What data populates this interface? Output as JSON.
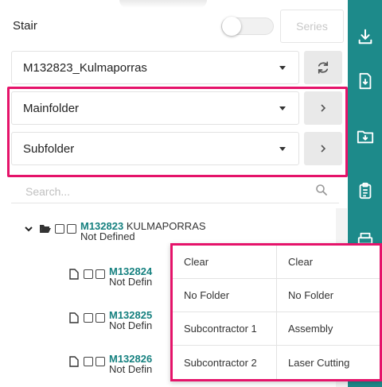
{
  "header": {
    "stair_label": "Stair",
    "series_label": "Series"
  },
  "dropdowns": {
    "project": "M132823_Kulmaporras",
    "mainfolder": "Mainfolder",
    "subfolder": "Subfolder"
  },
  "search": {
    "placeholder": "Search..."
  },
  "tree": {
    "root": {
      "code": "M132823",
      "name": "KULMAPORRAS",
      "status": "Not Defined"
    },
    "children": [
      {
        "code": "M132824",
        "status": "Not Defin"
      },
      {
        "code": "M132825",
        "status": "Not Defin"
      },
      {
        "code": "M132826",
        "status": "Not Defin"
      }
    ]
  },
  "popup": {
    "left": [
      "Clear",
      "No Folder",
      "Subcontractor 1",
      "Subcontractor 2"
    ],
    "right": [
      "Clear",
      "No Folder",
      "Assembly",
      "Laser Cutting"
    ]
  },
  "colors": {
    "accent": "#1d8a8a",
    "highlight": "#e5136a",
    "code_text": "#15807f"
  },
  "toolbar_icons": [
    "download-icon",
    "file-download-icon",
    "folder-download-icon",
    "clipboard-list-icon",
    "print-icon"
  ]
}
